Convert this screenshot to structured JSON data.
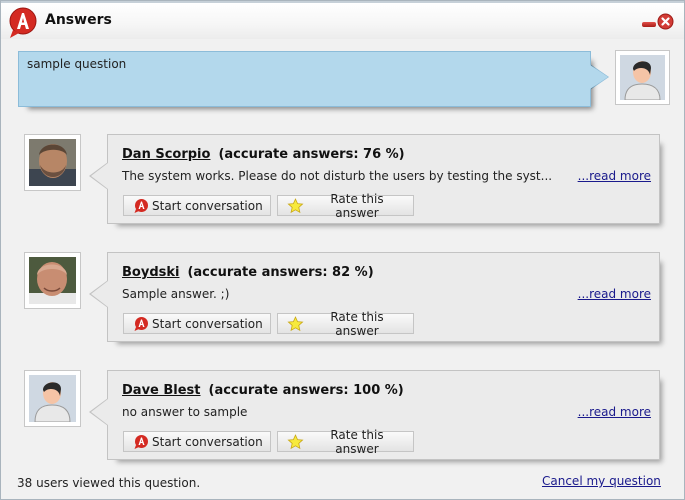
{
  "window": {
    "title": "Answers",
    "logo_icon": "app-logo-icon",
    "minimize_icon": "minimize-icon",
    "close_icon": "close-icon"
  },
  "question": {
    "text": "sample question",
    "asker_avatar_icon": "default-user-avatar"
  },
  "answers": [
    {
      "user": "Dan Scorpio",
      "accuracy": "(accurate answers: 76 %)",
      "text": "The system works. Please do not disturb the users by testing the syst...",
      "read_more": "...read more",
      "start_label": "Start conversation",
      "rate_label": "Rate this answer",
      "avatar": "photo"
    },
    {
      "user": "Boydski",
      "accuracy": "(accurate answers: 82 %)",
      "text": "Sample answer.  ;)",
      "read_more": "...read more",
      "start_label": "Start conversation",
      "rate_label": "Rate this answer",
      "avatar": "photo"
    },
    {
      "user": "Dave Blest",
      "accuracy": "(accurate answers: 100 %)",
      "text": "no answer to sample",
      "read_more": "...read more",
      "start_label": "Start conversation",
      "rate_label": "Rate this answer",
      "avatar": "default-user-avatar"
    }
  ],
  "footer": {
    "status": "38 users viewed this question.",
    "cancel_label": "Cancel my question"
  },
  "colors": {
    "question_bg": "#b3d8ec",
    "card_bg": "#ebebeb",
    "link": "#1a1a8c",
    "brand_red": "#d42a22"
  }
}
